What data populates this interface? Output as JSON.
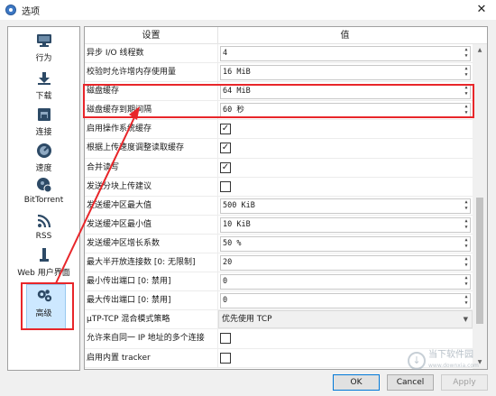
{
  "window": {
    "title": "选项"
  },
  "sidebar": {
    "items": [
      {
        "label": "行为",
        "icon": "monitor-icon"
      },
      {
        "label": "下载",
        "icon": "download-icon"
      },
      {
        "label": "连接",
        "icon": "network-icon"
      },
      {
        "label": "速度",
        "icon": "speedometer-icon"
      },
      {
        "label": "BitTorrent",
        "icon": "bittorrent-icon"
      },
      {
        "label": "RSS",
        "icon": "rss-icon"
      },
      {
        "label": "Web 用户界面",
        "icon": "web-ui-icon"
      },
      {
        "label": "高级",
        "icon": "gears-icon",
        "selected": true
      }
    ]
  },
  "table": {
    "headers": [
      "设置",
      "值"
    ],
    "rows": [
      {
        "label": "异步 I/O 线程数",
        "type": "spin",
        "value": "4"
      },
      {
        "label": "校验时允许增内存使用量",
        "type": "spin",
        "value": "16 MiB"
      },
      {
        "label": "磁盘缓存",
        "type": "spin",
        "value": "64 MiB"
      },
      {
        "label": "磁盘缓存到期间隔",
        "type": "spin",
        "value": "60 秒"
      },
      {
        "label": "启用操作系统缓存",
        "type": "check",
        "checked": true
      },
      {
        "label": "根据上传速度调整读取缓存",
        "type": "check",
        "checked": true
      },
      {
        "label": "合并读写",
        "type": "check",
        "checked": true
      },
      {
        "label": "发送分块上传建议",
        "type": "check",
        "checked": false
      },
      {
        "label": "发送缓冲区最大值",
        "type": "spin",
        "value": "500 KiB"
      },
      {
        "label": "发送缓冲区最小值",
        "type": "spin",
        "value": "10 KiB"
      },
      {
        "label": "发送缓冲区增长系数",
        "type": "spin",
        "value": "50 %"
      },
      {
        "label": "最大半开放连接数 [0: 无限制]",
        "type": "spin",
        "value": "20"
      },
      {
        "label": "最小传出端口 [0: 禁用]",
        "type": "spin",
        "value": "0"
      },
      {
        "label": "最大传出端口 [0: 禁用]",
        "type": "spin",
        "value": "0"
      },
      {
        "label": "µTP-TCP 混合模式策略",
        "type": "combo",
        "value": "优先使用 TCP"
      },
      {
        "label": "允许来自同一 IP 地址的多个连接",
        "type": "check",
        "checked": false
      },
      {
        "label": "启用内置 tracker",
        "type": "check",
        "checked": false
      }
    ]
  },
  "buttons": {
    "ok": "OK",
    "cancel": "Cancel",
    "apply": "Apply"
  },
  "watermark": {
    "title": "当下软件园",
    "subtitle": "www.downxia.com"
  },
  "colors": {
    "annotation": "#e8262a",
    "selection": "#cde8ff"
  }
}
